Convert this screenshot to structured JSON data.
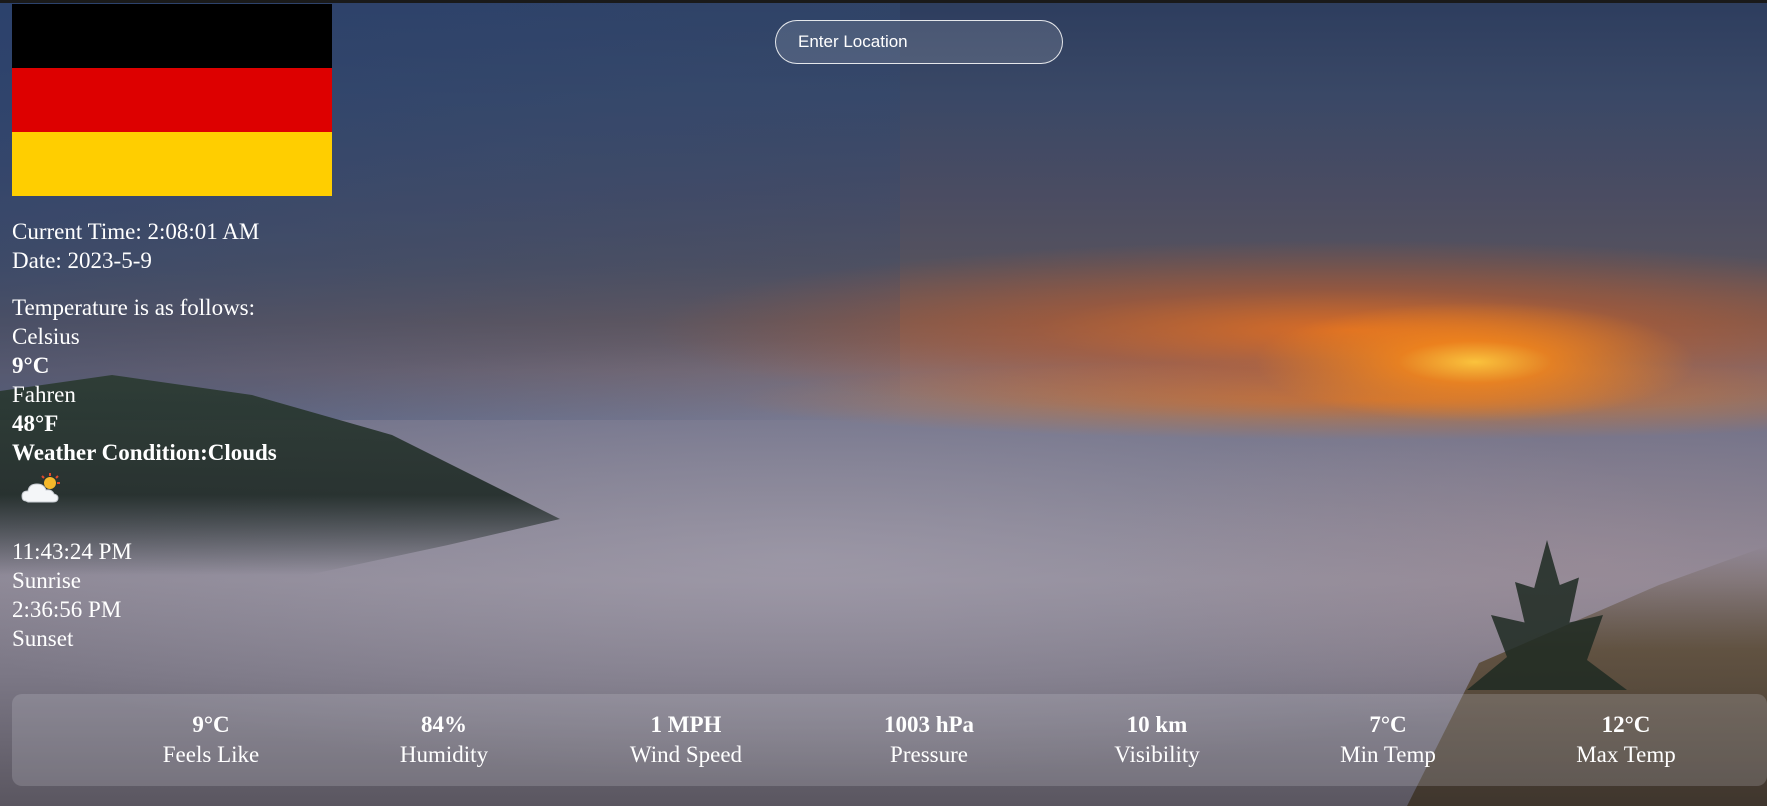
{
  "search": {
    "placeholder": "Enter Location"
  },
  "flag": {
    "name": "flag-germany",
    "colors": [
      "#000000",
      "#DD0000",
      "#FFCE00"
    ]
  },
  "info": {
    "current_time": "Current Time: 2:08:01 AM",
    "date": "Date: 2023-5-9",
    "temp_heading": "Temperature is as follows:",
    "celsius_label": "Celsius",
    "celsius_value": "9°C",
    "fahren_label": "Fahren",
    "fahren_value": "48°F",
    "condition": "Weather Condition:Clouds",
    "condition_icon": "cloud-sun-icon",
    "sunrise_time": "11:43:24 PM",
    "sunrise_label": "Sunrise",
    "sunset_time": "2:36:56 PM",
    "sunset_label": "Sunset"
  },
  "stats": [
    {
      "value": "9°C",
      "label": "Feels Like"
    },
    {
      "value": "84%",
      "label": "Humidity"
    },
    {
      "value": "1 MPH",
      "label": "Wind Speed"
    },
    {
      "value": "1003 hPa",
      "label": "Pressure"
    },
    {
      "value": "10 km",
      "label": "Visibility"
    },
    {
      "value": "7°C",
      "label": "Min Temp"
    },
    {
      "value": "12°C",
      "label": "Max Temp"
    }
  ]
}
